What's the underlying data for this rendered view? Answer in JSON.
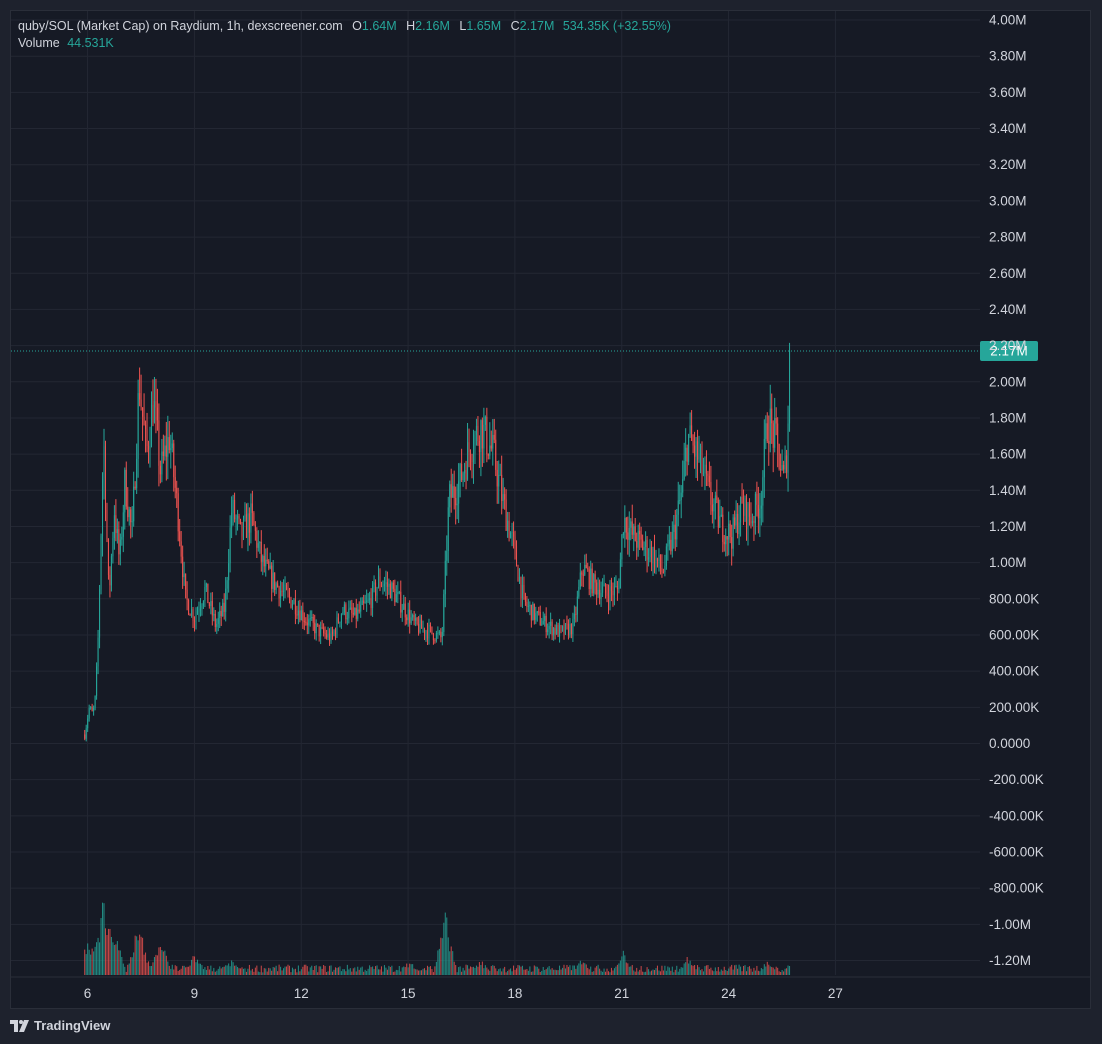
{
  "legend": {
    "symbol_line": "quby/SOL (Market Cap) on Raydium, 1h, dexscreener.com",
    "o_label": "O",
    "o_value": "1.64M",
    "h_label": "H",
    "h_value": "2.16M",
    "l_label": "L",
    "l_value": "1.65M",
    "c_label": "C",
    "c_value": "2.17M",
    "change": "534.35K (+32.55%)",
    "volume_label": "Volume",
    "volume_value": "44.531K"
  },
  "brand": {
    "name": "TradingView",
    "logo_icon": "tradingview-logo-icon"
  },
  "colors": {
    "up": "#26a69a",
    "down": "#ef5350",
    "background": "#161a25",
    "grid": "#232733",
    "text": "#d1d4dc",
    "price_tag": "#26a69a"
  },
  "chart_data": {
    "type": "candlestick",
    "timeframe": "1h",
    "price_axis_labels": [
      "4.00M",
      "3.80M",
      "3.60M",
      "3.40M",
      "3.20M",
      "3.00M",
      "2.80M",
      "2.60M",
      "2.40M",
      "2.20M",
      "2.00M",
      "1.80M",
      "1.60M",
      "1.40M",
      "1.20M",
      "1.00M",
      "800.00K",
      "600.00K",
      "400.00K",
      "200.00K",
      "0.0000",
      "-200.00K",
      "-400.00K",
      "-600.00K",
      "-800.00K",
      "-1.00M",
      "-1.20M"
    ],
    "price_axis_values": [
      4000000,
      3800000,
      3600000,
      3400000,
      3200000,
      3000000,
      2800000,
      2600000,
      2400000,
      2200000,
      2000000,
      1800000,
      1600000,
      1400000,
      1200000,
      1000000,
      800000,
      600000,
      400000,
      200000,
      0,
      -200000,
      -400000,
      -600000,
      -800000,
      -1000000,
      -1200000
    ],
    "ylim": [
      -1280000,
      4050000
    ],
    "time_axis_labels": [
      "6",
      "9",
      "12",
      "15",
      "18",
      "21",
      "24",
      "27"
    ],
    "time_axis_days": [
      6,
      9,
      12,
      15,
      18,
      21,
      24,
      27
    ],
    "xlim": [
      3.85,
      31.06
    ],
    "last_price": 2170000,
    "last_price_label": "2.17M",
    "grid": true,
    "legend_position": "top-left",
    "close_anchors": [
      [
        5.92,
        50000
      ],
      [
        6.05,
        200000
      ],
      [
        6.15,
        160000
      ],
      [
        6.22,
        260000
      ],
      [
        6.3,
        600000
      ],
      [
        6.45,
        1700000
      ],
      [
        6.6,
        800000
      ],
      [
        6.75,
        1300000
      ],
      [
        6.9,
        1000000
      ],
      [
        7.05,
        1450000
      ],
      [
        7.25,
        1150000
      ],
      [
        7.45,
        2000000
      ],
      [
        7.65,
        1600000
      ],
      [
        7.85,
        1900000
      ],
      [
        8.05,
        1500000
      ],
      [
        8.3,
        1700000
      ],
      [
        8.55,
        1250000
      ],
      [
        8.75,
        800000
      ],
      [
        9.0,
        700000
      ],
      [
        9.3,
        850000
      ],
      [
        9.6,
        650000
      ],
      [
        9.85,
        750000
      ],
      [
        10.05,
        1300000
      ],
      [
        10.3,
        1150000
      ],
      [
        10.6,
        1250000
      ],
      [
        10.9,
        1000000
      ],
      [
        11.2,
        900000
      ],
      [
        11.5,
        830000
      ],
      [
        11.8,
        780000
      ],
      [
        12.15,
        680000
      ],
      [
        12.5,
        620000
      ],
      [
        12.85,
        580000
      ],
      [
        13.15,
        740000
      ],
      [
        13.5,
        700000
      ],
      [
        13.9,
        780000
      ],
      [
        14.2,
        900000
      ],
      [
        14.5,
        860000
      ],
      [
        14.85,
        760000
      ],
      [
        15.2,
        650000
      ],
      [
        15.6,
        620000
      ],
      [
        15.95,
        580000
      ],
      [
        16.15,
        1350000
      ],
      [
        16.45,
        1450000
      ],
      [
        16.75,
        1650000
      ],
      [
        17.05,
        1750000
      ],
      [
        17.4,
        1600000
      ],
      [
        17.65,
        1350000
      ],
      [
        17.95,
        1100000
      ],
      [
        18.25,
        780000
      ],
      [
        18.6,
        700000
      ],
      [
        18.95,
        650000
      ],
      [
        19.3,
        610000
      ],
      [
        19.65,
        650000
      ],
      [
        19.9,
        980000
      ],
      [
        20.2,
        880000
      ],
      [
        20.55,
        830000
      ],
      [
        20.9,
        850000
      ],
      [
        21.05,
        1250000
      ],
      [
        21.3,
        1150000
      ],
      [
        21.55,
        1100000
      ],
      [
        21.85,
        1050000
      ],
      [
        22.15,
        950000
      ],
      [
        22.45,
        1150000
      ],
      [
        22.7,
        1400000
      ],
      [
        22.85,
        1700000
      ],
      [
        23.2,
        1550000
      ],
      [
        23.5,
        1350000
      ],
      [
        23.8,
        1200000
      ],
      [
        24.1,
        1150000
      ],
      [
        24.35,
        1300000
      ],
      [
        24.65,
        1250000
      ],
      [
        24.9,
        1350000
      ],
      [
        25.1,
        1800000
      ],
      [
        25.35,
        1650000
      ],
      [
        25.55,
        1450000
      ],
      [
        25.65,
        1650000
      ],
      [
        25.72,
        2170000
      ]
    ],
    "volume_spikes": [
      [
        6.0,
        0.3
      ],
      [
        6.3,
        0.45
      ],
      [
        6.45,
        0.62
      ],
      [
        6.6,
        0.55
      ],
      [
        6.75,
        0.4
      ],
      [
        7.45,
        0.45
      ],
      [
        8.05,
        0.3
      ],
      [
        9.0,
        0.18
      ],
      [
        10.05,
        0.12
      ],
      [
        15.05,
        0.12
      ],
      [
        16.05,
        0.5
      ],
      [
        17.05,
        0.12
      ],
      [
        19.9,
        0.15
      ],
      [
        21.05,
        0.2
      ],
      [
        22.85,
        0.15
      ],
      [
        25.1,
        0.12
      ],
      [
        25.72,
        0.1
      ]
    ],
    "volume_axis_max": 1.0
  }
}
